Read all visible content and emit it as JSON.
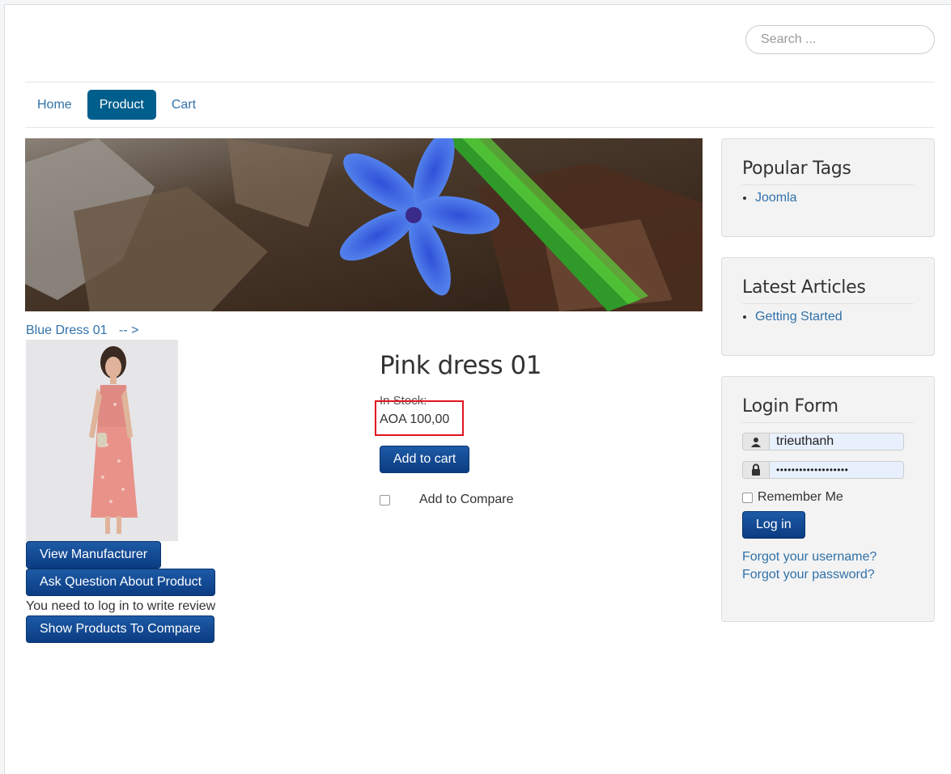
{
  "search": {
    "placeholder": "Search ..."
  },
  "nav": {
    "items": [
      {
        "label": "Home"
      },
      {
        "label": "Product"
      },
      {
        "label": "Cart"
      }
    ]
  },
  "breadcrumb": {
    "previous_product": "Blue Dress 01",
    "next_label": "-- >"
  },
  "product": {
    "title": "Pink dress 01",
    "stock": "In Stock:",
    "price": "AOA 100,00",
    "add_to_cart": "Add to cart",
    "add_to_compare": "Add to Compare",
    "view_manufacturer": "View Manufacturer",
    "ask_question": "Ask Question About Product",
    "review_notice": "You need to log in to write review",
    "show_compare": "Show Products To Compare"
  },
  "sidebar": {
    "popular_tags": {
      "title": "Popular Tags",
      "items": [
        "Joomla"
      ]
    },
    "latest_articles": {
      "title": "Latest Articles",
      "items": [
        "Getting Started"
      ]
    },
    "login": {
      "title": "Login Form",
      "username": "trieuthanh",
      "password": "•••••••••••••••••••",
      "remember_label": "Remember Me",
      "login_button": "Log in",
      "forgot_username": "Forgot your username?",
      "forgot_password": "Forgot your password?"
    }
  },
  "colors": {
    "nav_active": "#005e8d",
    "link": "#3071a9",
    "button": "#0b3c82",
    "highlight": "#e0141e"
  }
}
